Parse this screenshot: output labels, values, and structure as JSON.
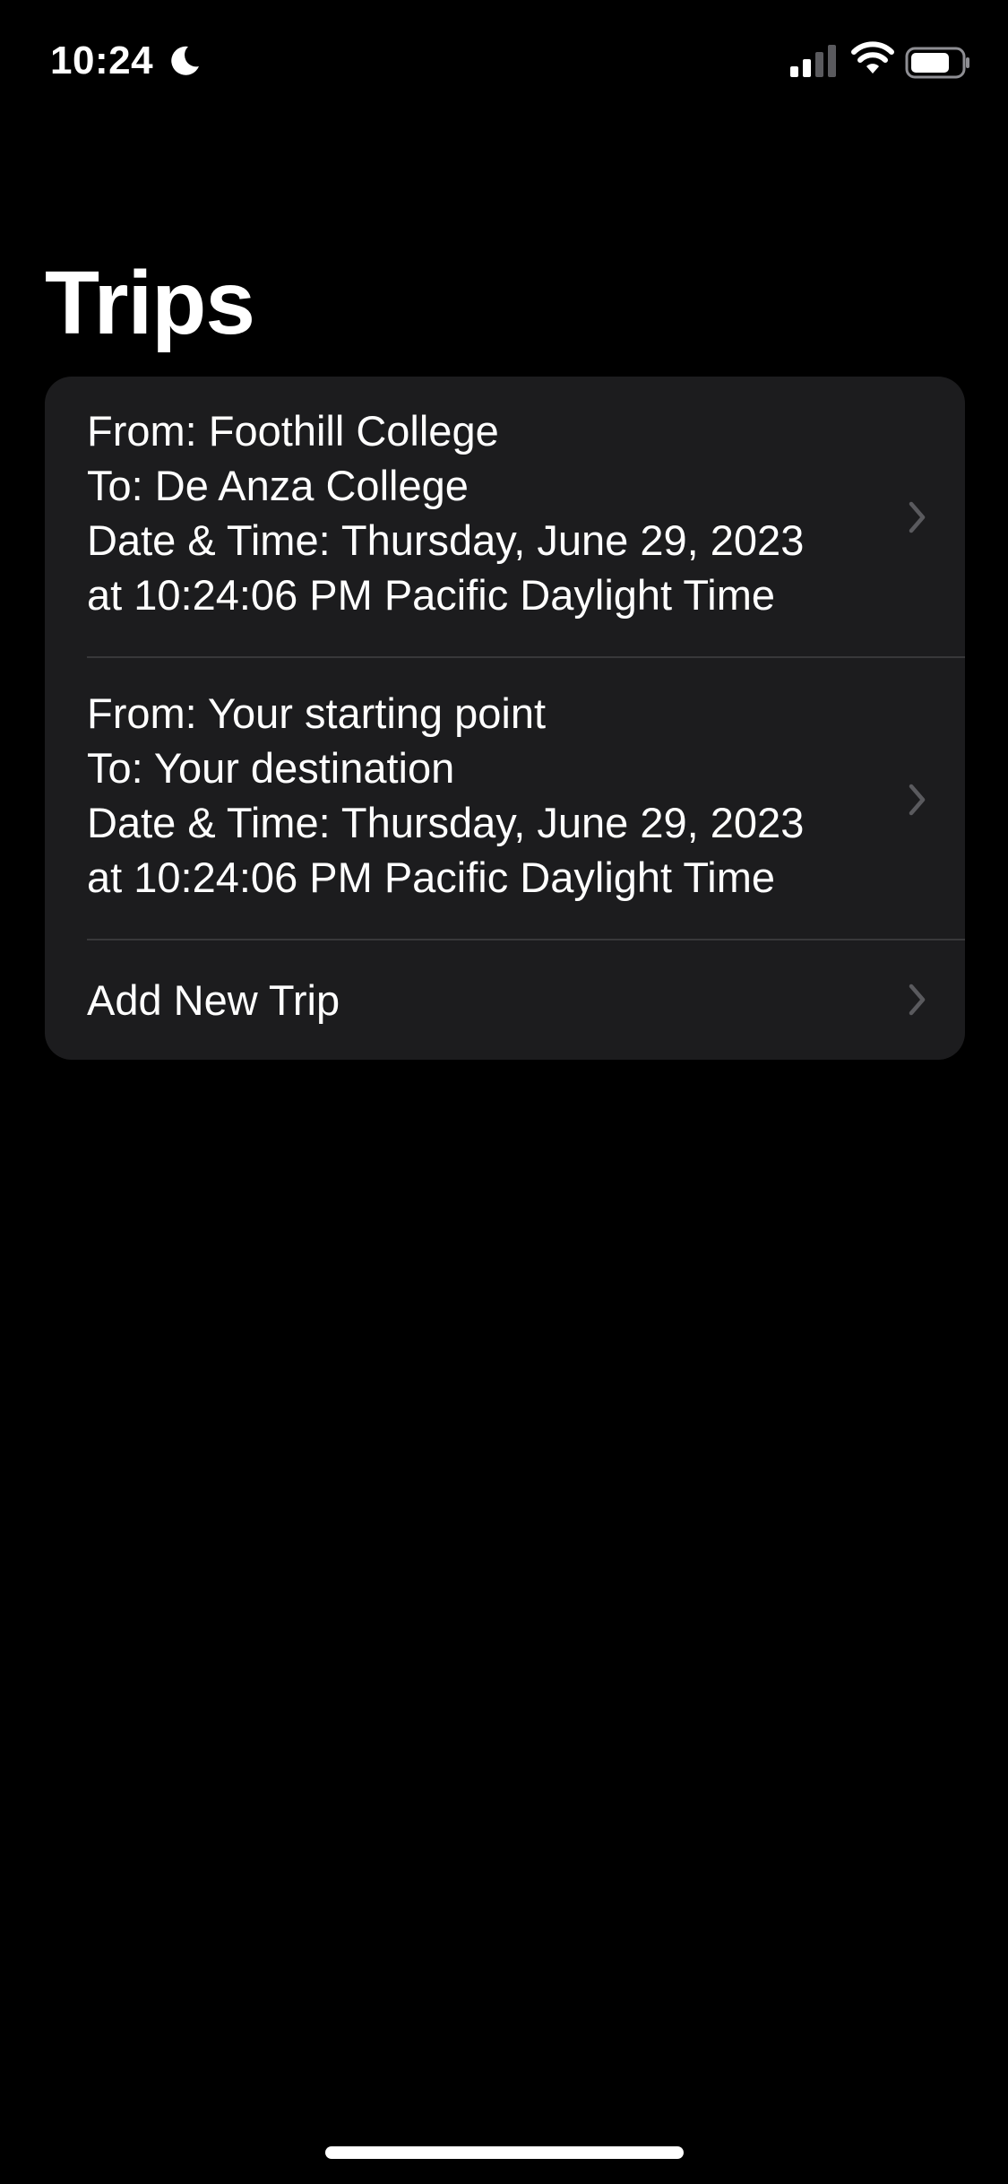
{
  "status_bar": {
    "time": "10:24",
    "icons": [
      "moon-icon",
      "signal-icon",
      "wifi-icon",
      "battery-icon"
    ]
  },
  "page": {
    "title": "Trips"
  },
  "trips": [
    {
      "from": "From: Foothill College",
      "to": "To: De Anza College",
      "date_line": "Date & Time: Thursday, June 29, 2023",
      "time_line": "at 10:24:06 PM Pacific Daylight Time"
    },
    {
      "from": "From: Your starting point",
      "to": "To: Your destination",
      "date_line": "Date & Time: Thursday, June 29, 2023",
      "time_line": "at 10:24:06 PM Pacific Daylight Time"
    }
  ],
  "add_trip": {
    "label": "Add New Trip"
  },
  "colors": {
    "background": "#000000",
    "cell_background": "#1c1c1e",
    "separator": "#38383a",
    "chevron": "#5a5a5e",
    "text": "#ffffff"
  }
}
